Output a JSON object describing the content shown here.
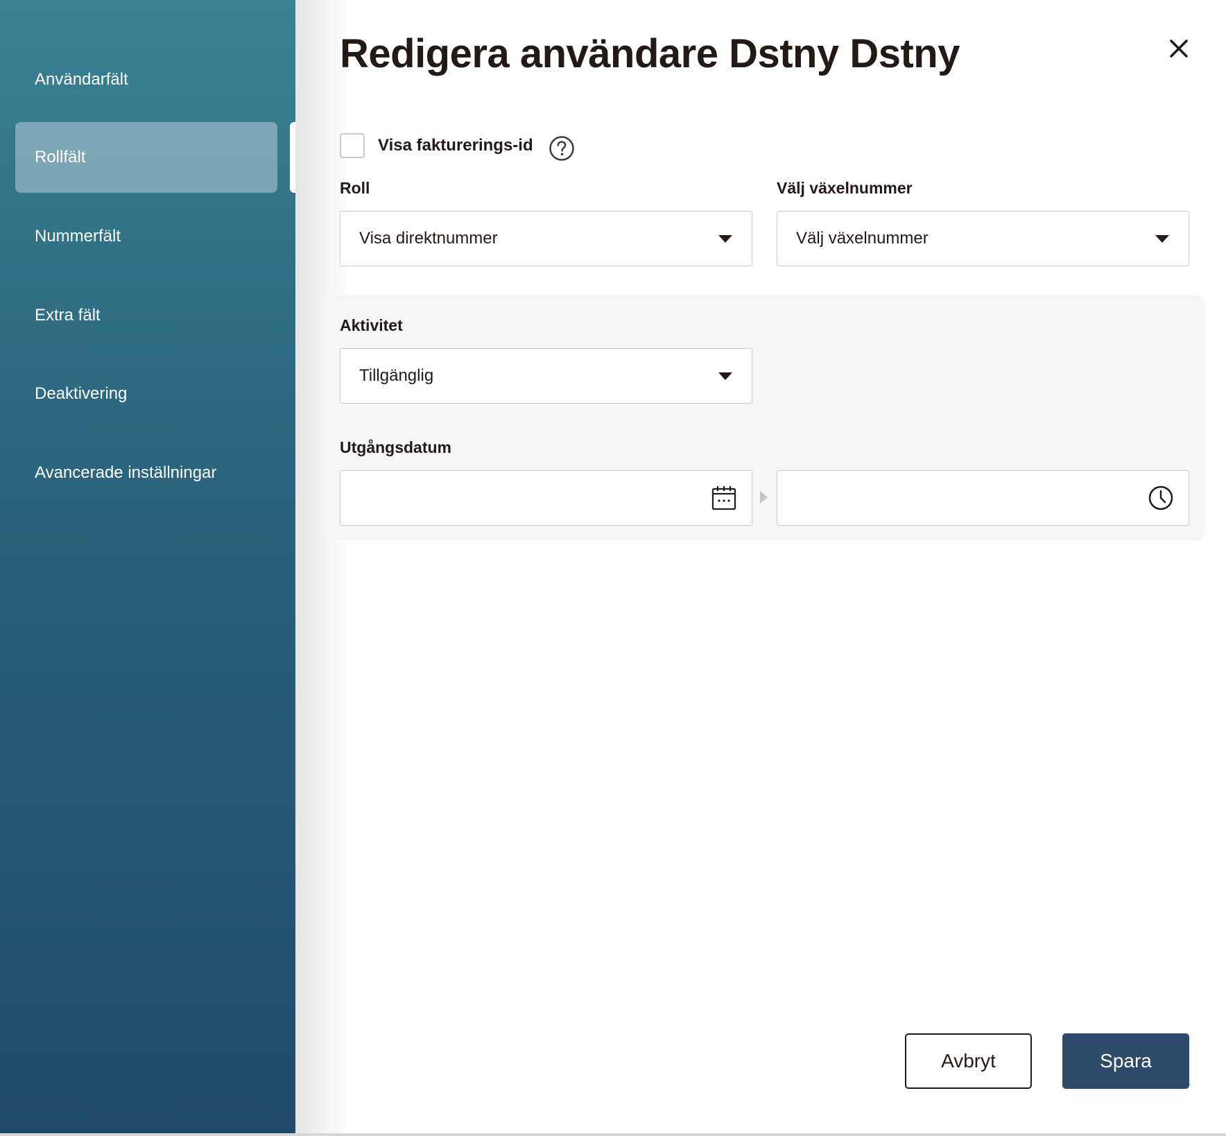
{
  "sidebar": {
    "items": [
      {
        "label": "Användarfält"
      },
      {
        "label": "Rollfält",
        "active": true
      },
      {
        "label": "Nummerfält"
      },
      {
        "label": "Extra fält"
      },
      {
        "label": "Deaktivering"
      },
      {
        "label": "Avancerade inställningar"
      }
    ]
  },
  "header": {
    "title": "Redigera användare Dstny Dstny",
    "close_icon": "close-icon"
  },
  "billing": {
    "checkbox_label": "Visa fakturerings-id",
    "checked": false,
    "help_icon": "question-circle-icon"
  },
  "role": {
    "label": "Roll",
    "value": "Visa direktnummer"
  },
  "switchboard": {
    "label": "Välj växelnummer",
    "value": "Välj växelnummer"
  },
  "activity": {
    "label": "Aktivitet",
    "value": "Tillgänglig"
  },
  "expiry": {
    "label": "Utgångsdatum",
    "date_value": "",
    "time_value": "",
    "date_icon": "calendar-icon",
    "time_icon": "clock-icon"
  },
  "footer": {
    "cancel_label": "Avbryt",
    "save_label": "Spara"
  },
  "colors": {
    "sidebar_top": "#3a8194",
    "sidebar_bottom": "#1f4a6b",
    "primary_button": "#2c4a6a",
    "text": "#231916",
    "panel_bg": "#f4f5f6"
  }
}
